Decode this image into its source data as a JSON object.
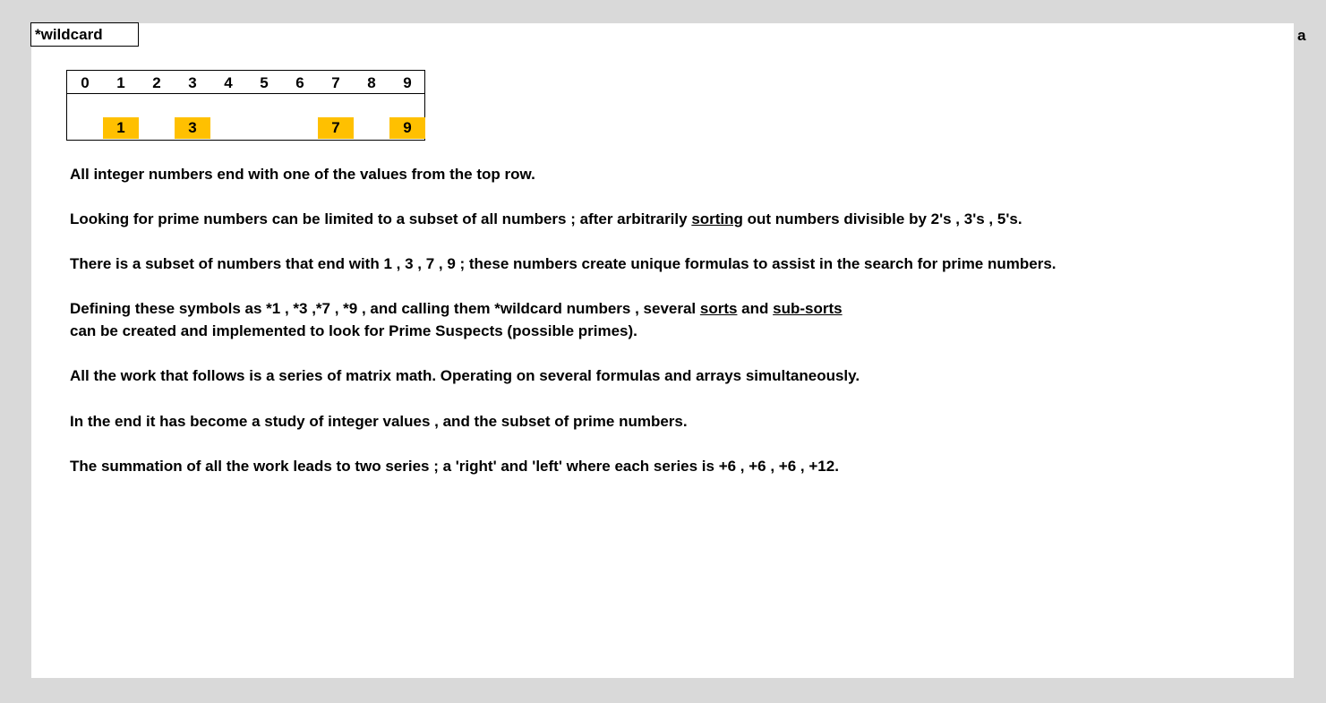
{
  "header": {
    "title": "*wildcard",
    "corner_label": "a"
  },
  "digits": {
    "top_row": [
      "0",
      "1",
      "2",
      "3",
      "4",
      "5",
      "6",
      "7",
      "8",
      "9"
    ],
    "highlighted": [
      {
        "label": "1",
        "index": 1
      },
      {
        "label": "3",
        "index": 3
      },
      {
        "label": "7",
        "index": 7
      },
      {
        "label": "9",
        "index": 9
      }
    ],
    "highlight_color": "#ffc000"
  },
  "paragraphs": {
    "p1": "All integer numbers end with one of the values from the top row.",
    "p2a": "Looking for prime numbers can be limited to a subset of all numbers ; after arbitrarily ",
    "p2u": "sorting",
    "p2b": " out numbers divisible by 2's , 3's , 5's.",
    "p3": "There is a subset of numbers that end with 1 , 3 , 7 , 9 ; these numbers create unique formulas to assist in the search for prime numbers.",
    "p4a": "Defining these symbols as *1 , *3 ,*7 , *9 , and calling them *wildcard numbers , several ",
    "p4u1": "sorts",
    "p4b": " and ",
    "p4u2": "sub-sorts",
    "p4c": "can be created and implemented to look for Prime Suspects (possible primes).",
    "p5": "All the work that follows is a series of matrix math. Operating on several formulas and arrays simultaneously.",
    "p6": "In the end it has become a study of integer values , and the subset of prime numbers.",
    "p7": "The summation of all the work leads to two series ; a 'right' and 'left' where each series is +6 , +6 , +6 , +12."
  }
}
